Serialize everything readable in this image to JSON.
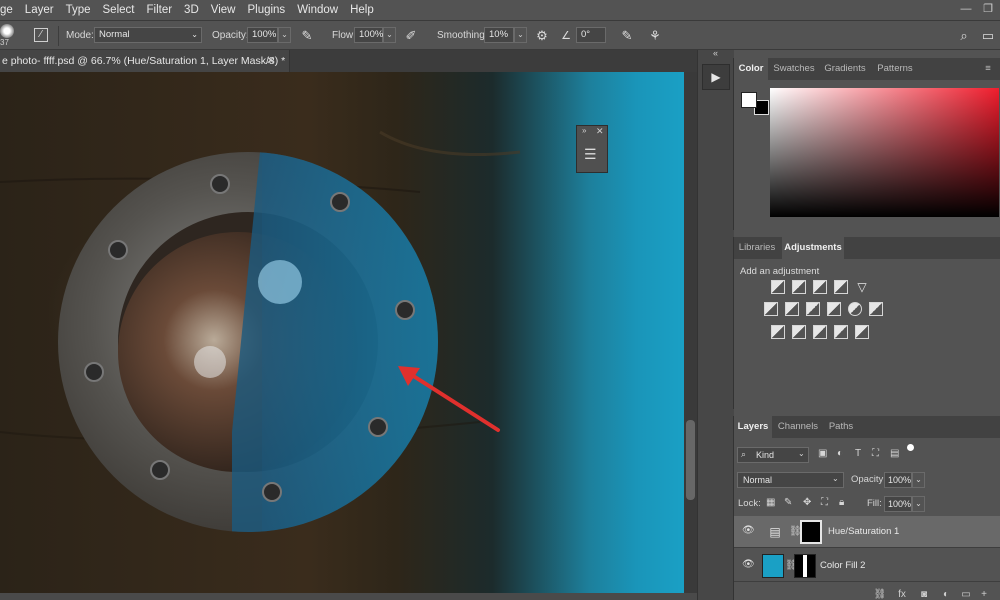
{
  "menu": {
    "items": [
      "ge",
      "Layer",
      "Type",
      "Select",
      "Filter",
      "3D",
      "View",
      "Plugins",
      "Window",
      "Help"
    ]
  },
  "options_bar": {
    "brush_size": "37",
    "mode_label": "Mode:",
    "mode_value": "Normal",
    "opacity_label": "Opacity:",
    "opacity_value": "100%",
    "flow_label": "Flow:",
    "flow_value": "100%",
    "smoothing_label": "Smoothing:",
    "smoothing_value": "10%",
    "angle_value": "0°"
  },
  "document": {
    "tab_title": "e photo- ffff.psd @ 66.7% (Hue/Saturation 1, Layer Mask/8) *",
    "close": "✕"
  },
  "color_panel": {
    "tabs": [
      "Color",
      "Swatches",
      "Gradients",
      "Patterns"
    ],
    "active_tab": "Color"
  },
  "adjustments_panel": {
    "tabs": [
      "Libraries",
      "Adjustments"
    ],
    "active_tab": "Adjustments",
    "heading": "Add an adjustment"
  },
  "layers_panel": {
    "tabs": [
      "Layers",
      "Channels",
      "Paths"
    ],
    "active_tab": "Layers",
    "filter_kind": "Kind",
    "blend_mode": "Normal",
    "opacity_label": "Opacity:",
    "opacity_value": "100%",
    "lock_label": "Lock:",
    "fill_label": "Fill:",
    "fill_value": "100%",
    "layers": [
      {
        "name": "Hue/Saturation 1",
        "selected": true
      },
      {
        "name": "Color Fill 2",
        "selected": false
      }
    ]
  },
  "colors": {
    "accent_cyan": "#1aa0c5",
    "arrow_red": "#e0302d"
  }
}
